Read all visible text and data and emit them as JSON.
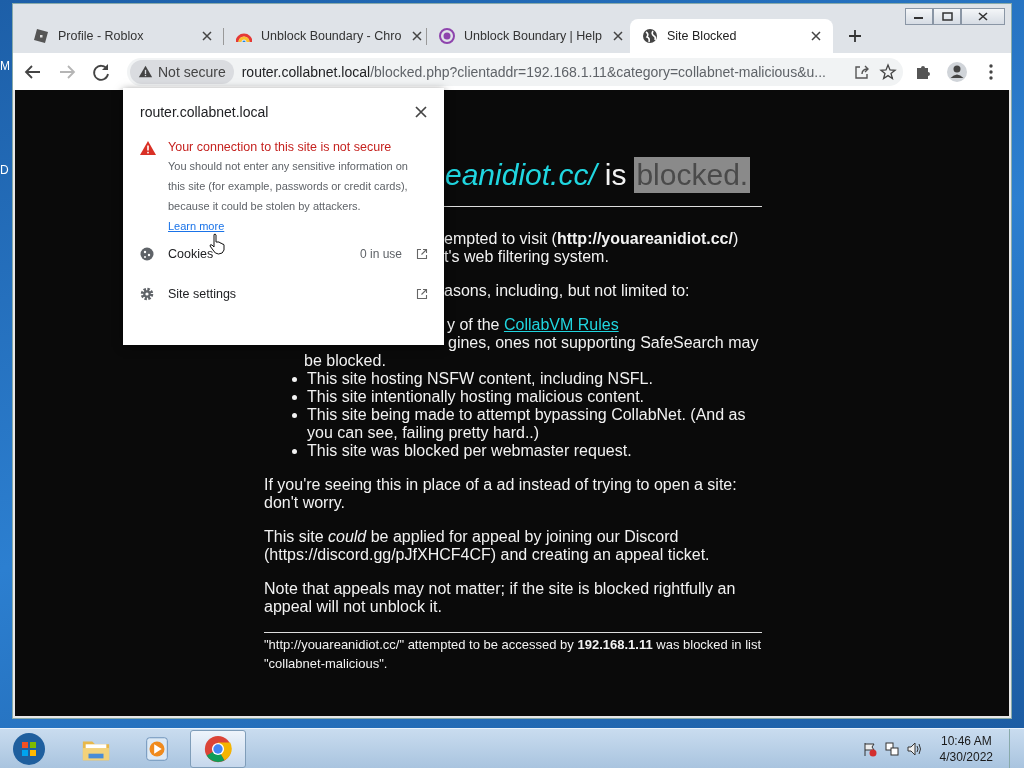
{
  "desktop_labels": [
    "M",
    "D"
  ],
  "tabs": [
    {
      "title": "Profile - Roblox",
      "kind": "roblox",
      "selected": false
    },
    {
      "title": "Unblock Boundary - Chro",
      "kind": "rainbow",
      "selected": false
    },
    {
      "title": "Unblock Boundary | Help",
      "kind": "purple",
      "selected": false
    },
    {
      "title": "Site Blocked",
      "kind": "globe",
      "selected": true
    }
  ],
  "toolbar": {
    "forward_disabled": true,
    "security_chip": "Not secure",
    "url_host": "router.collabnet.local",
    "url_rest": "/blocked.php?clientaddr=192.168.1.11&category=collabnet-malicious&u..."
  },
  "site_popup": {
    "title": "router.collabnet.local",
    "warning_title": "Your connection to this site is not secure",
    "warning_text": "You should not enter any sensitive information on this site (for example, passwords or credit cards), because it could be stolen by attackers.",
    "link": "Learn more",
    "rows": [
      {
        "kind": "cookies",
        "label": "Cookies",
        "value": "0 in use"
      },
      {
        "kind": "settings",
        "label": "Site settings"
      }
    ]
  },
  "page": {
    "heading_site": "eanidiot.cc/",
    "heading_middle": "is",
    "heading_status": "blocked.",
    "intro_lines": [
      "empted to visit (**http://youareanidiot.cc/**)",
      "t's web filtering system."
    ],
    "reasons_intro": "asons, including, but not limited to:",
    "rules_text": "y of the",
    "rules_link": "CollabVM Rules",
    "search_lines": [
      "gines, ones not supporting SafeSearch may",
      "be blocked."
    ],
    "reasons": [
      "This site hosting NSFW content, including NSFL.",
      "This site intentionally hosting malicious content.",
      "This site being made to attempt bypassing CollabNet. (And as you can see, failing pretty hard..)",
      "This site was blocked per webmaster request."
    ],
    "paragraphs": [
      "If you're seeing this in place of a ad instead of trying to open a site: don't worry.",
      "This site *could* be applied for appeal by joining our Discord (https://discord.gg/pJfXHCF4CF) and creating an appeal ticket.",
      "Note that appeals may not matter; if the site is blocked rightfully an appeal will not unblock it."
    ],
    "footer": "\"http://youareanidiot.cc/\" attempted to be accessed by **192.168.1.11** was blocked in list \"collabnet-malicious\"."
  },
  "taskbar": {
    "apps": [
      {
        "kind": "explorer",
        "selected": false
      },
      {
        "kind": "media",
        "selected": false
      },
      {
        "kind": "chrome",
        "selected": true
      }
    ],
    "time": "10:46 AM",
    "date": "4/30/2022"
  }
}
